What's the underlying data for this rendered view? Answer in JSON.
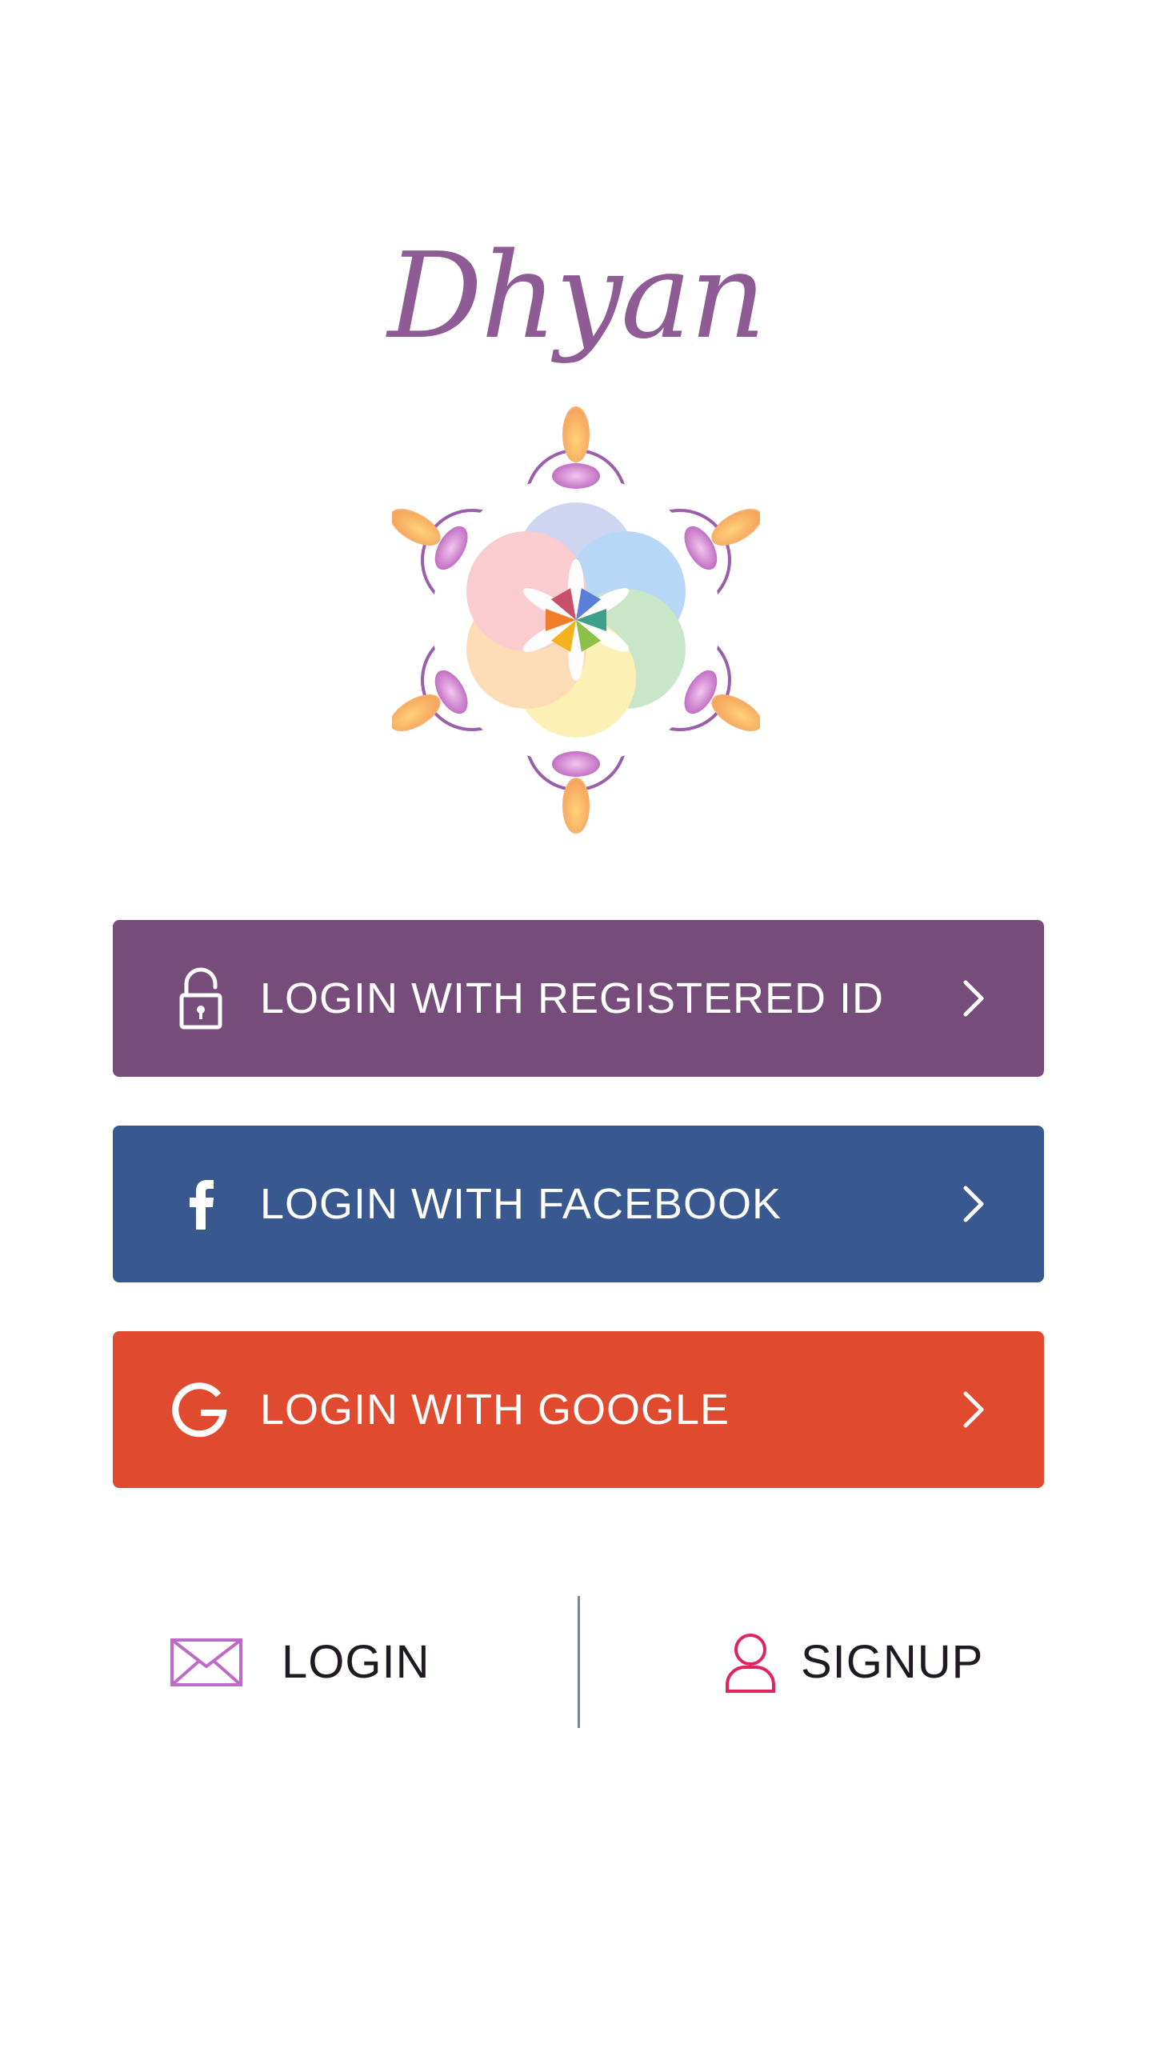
{
  "app": {
    "title": "Dhyan"
  },
  "colors": {
    "brand": "#8e5b94",
    "registered": "#764c7a",
    "facebook": "#39588f",
    "google": "#e04a2f",
    "mail_icon": "#c06ac7",
    "user_icon": "#e0245e"
  },
  "buttons": [
    {
      "label": "LOGIN WITH REGISTERED ID",
      "icon": "unlock-icon"
    },
    {
      "label": "LOGIN WITH FACEBOOK",
      "icon": "facebook-icon"
    },
    {
      "label": "LOGIN WITH GOOGLE",
      "icon": "google-icon"
    }
  ],
  "bottom": {
    "login_label": "LOGIN",
    "login_icon": "mail-icon",
    "signup_label": "SIGNUP",
    "signup_icon": "user-icon"
  }
}
